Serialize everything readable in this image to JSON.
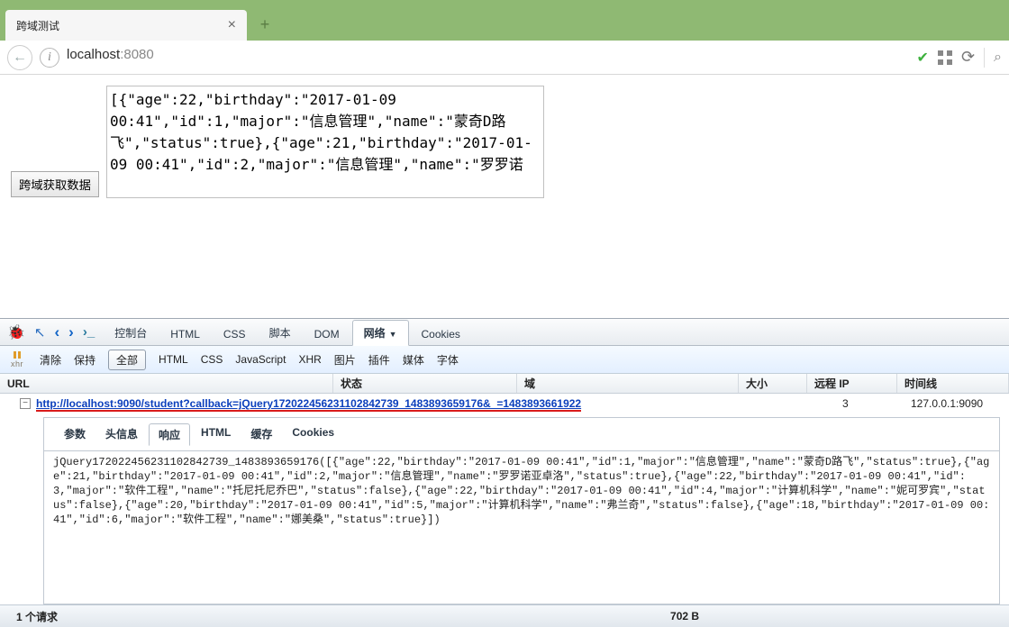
{
  "browser": {
    "tab_title": "跨域测试",
    "url_host": "localhost",
    "url_port": ":8080"
  },
  "page": {
    "button_label": "跨域获取数据",
    "textarea_content": "[{\"age\":22,\"birthday\":\"2017-01-09 00:41\",\"id\":1,\"major\":\"信息管理\",\"name\":\"蒙奇D路飞\",\"status\":true},{\"age\":21,\"birthday\":\"2017-01-09 00:41\",\"id\":2,\"major\":\"信息管理\",\"name\":\"罗罗诺"
  },
  "devtools": {
    "top_tabs": {
      "console": "控制台",
      "html": "HTML",
      "css": "CSS",
      "script": "脚本",
      "dom": "DOM",
      "network": "网络",
      "cookies": "Cookies"
    },
    "xhr_label": "xhr",
    "subbar": {
      "clear": "清除",
      "persist": "保持",
      "all": "全部",
      "html": "HTML",
      "css": "CSS",
      "js": "JavaScript",
      "xhr": "XHR",
      "image": "图片",
      "plugin": "插件",
      "media": "媒体",
      "font": "字体"
    },
    "columns": {
      "url": "URL",
      "status": "状态",
      "domain": "域",
      "size": "大小",
      "remote_ip": "远程 IP",
      "timeline": "时间线"
    },
    "request": {
      "url": "http://localhost:9090/student?callback=jQuery172022456231102842739_1483893659176&_=1483893661922",
      "size": "3",
      "remote_ip": "127.0.0.1:9090"
    },
    "detail_tabs": {
      "params": "参数",
      "headers": "头信息",
      "response": "响应",
      "html": "HTML",
      "cache": "缓存",
      "cookies": "Cookies"
    },
    "response_body": "jQuery172022456231102842739_1483893659176([{\"age\":22,\"birthday\":\"2017-01-09 00:41\",\"id\":1,\"major\":\"信息管理\",\"name\":\"蒙奇D路飞\",\"status\":true},{\"age\":21,\"birthday\":\"2017-01-09 00:41\",\"id\":2,\"major\":\"信息管理\",\"name\":\"罗罗诺亚卓洛\",\"status\":true},{\"age\":22,\"birthday\":\"2017-01-09 00:41\",\"id\":3,\"major\":\"软件工程\",\"name\":\"托尼托尼乔巴\",\"status\":false},{\"age\":22,\"birthday\":\"2017-01-09 00:41\",\"id\":4,\"major\":\"计算机科学\",\"name\":\"妮可罗宾\",\"status\":false},{\"age\":20,\"birthday\":\"2017-01-09 00:41\",\"id\":5,\"major\":\"计算机科学\",\"name\":\"弗兰奇\",\"status\":false},{\"age\":18,\"birthday\":\"2017-01-09 00:41\",\"id\":6,\"major\":\"软件工程\",\"name\":\"娜美桑\",\"status\":true}])",
    "statusbar": {
      "requests": "1 个请求",
      "bytes": "702 B"
    }
  }
}
